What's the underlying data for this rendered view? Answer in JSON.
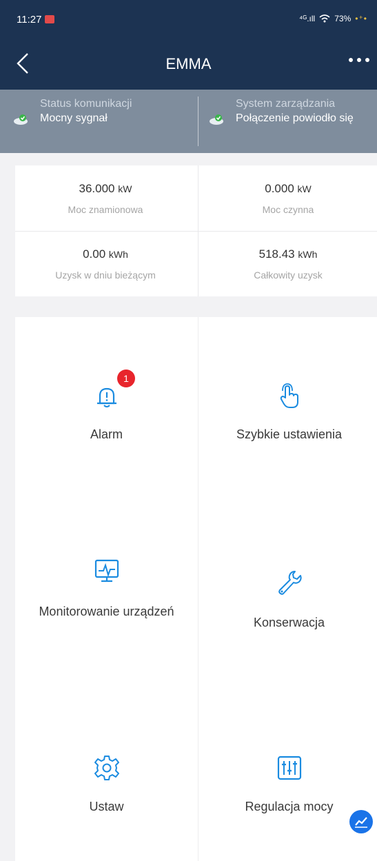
{
  "status_bar": {
    "time": "11:27",
    "signal": "⁴ᴳ.ıll",
    "battery": "73%"
  },
  "header": {
    "title": "EMMA",
    "back_glyph": "‹",
    "more_glyph": "•••"
  },
  "status_strip": {
    "left": {
      "label": "Status komunikacji",
      "value": "Mocny sygnał"
    },
    "right": {
      "label": "System zarządzania",
      "value": "Połączenie powiodło się"
    }
  },
  "stats": [
    {
      "value": "36.000",
      "unit": "kW",
      "label": "Moc znamionowa"
    },
    {
      "value": "0.000",
      "unit": "kW",
      "label": "Moc czynna"
    },
    {
      "value": "0.00",
      "unit": "kWh",
      "label": "Uzysk w dniu bieżącym"
    },
    {
      "value": "518.43",
      "unit": "kWh",
      "label": "Całkowity uzysk"
    }
  ],
  "tiles": [
    {
      "label": "Alarm",
      "icon": "bell-icon",
      "badge": "1"
    },
    {
      "label": "Szybkie ustawienia",
      "icon": "touch-icon"
    },
    {
      "label": "Monitorowanie urządzeń",
      "icon": "monitor-icon"
    },
    {
      "label": "Konserwacja",
      "icon": "wrench-icon"
    },
    {
      "label": "Ustaw",
      "icon": "gear-icon"
    },
    {
      "label": "Regulacja mocy",
      "icon": "sliders-icon"
    }
  ],
  "colors": {
    "header_bg": "#1c3352",
    "strip_bg": "#7f8d9d",
    "accent": "#1a8be0",
    "badge": "#e8252c"
  }
}
